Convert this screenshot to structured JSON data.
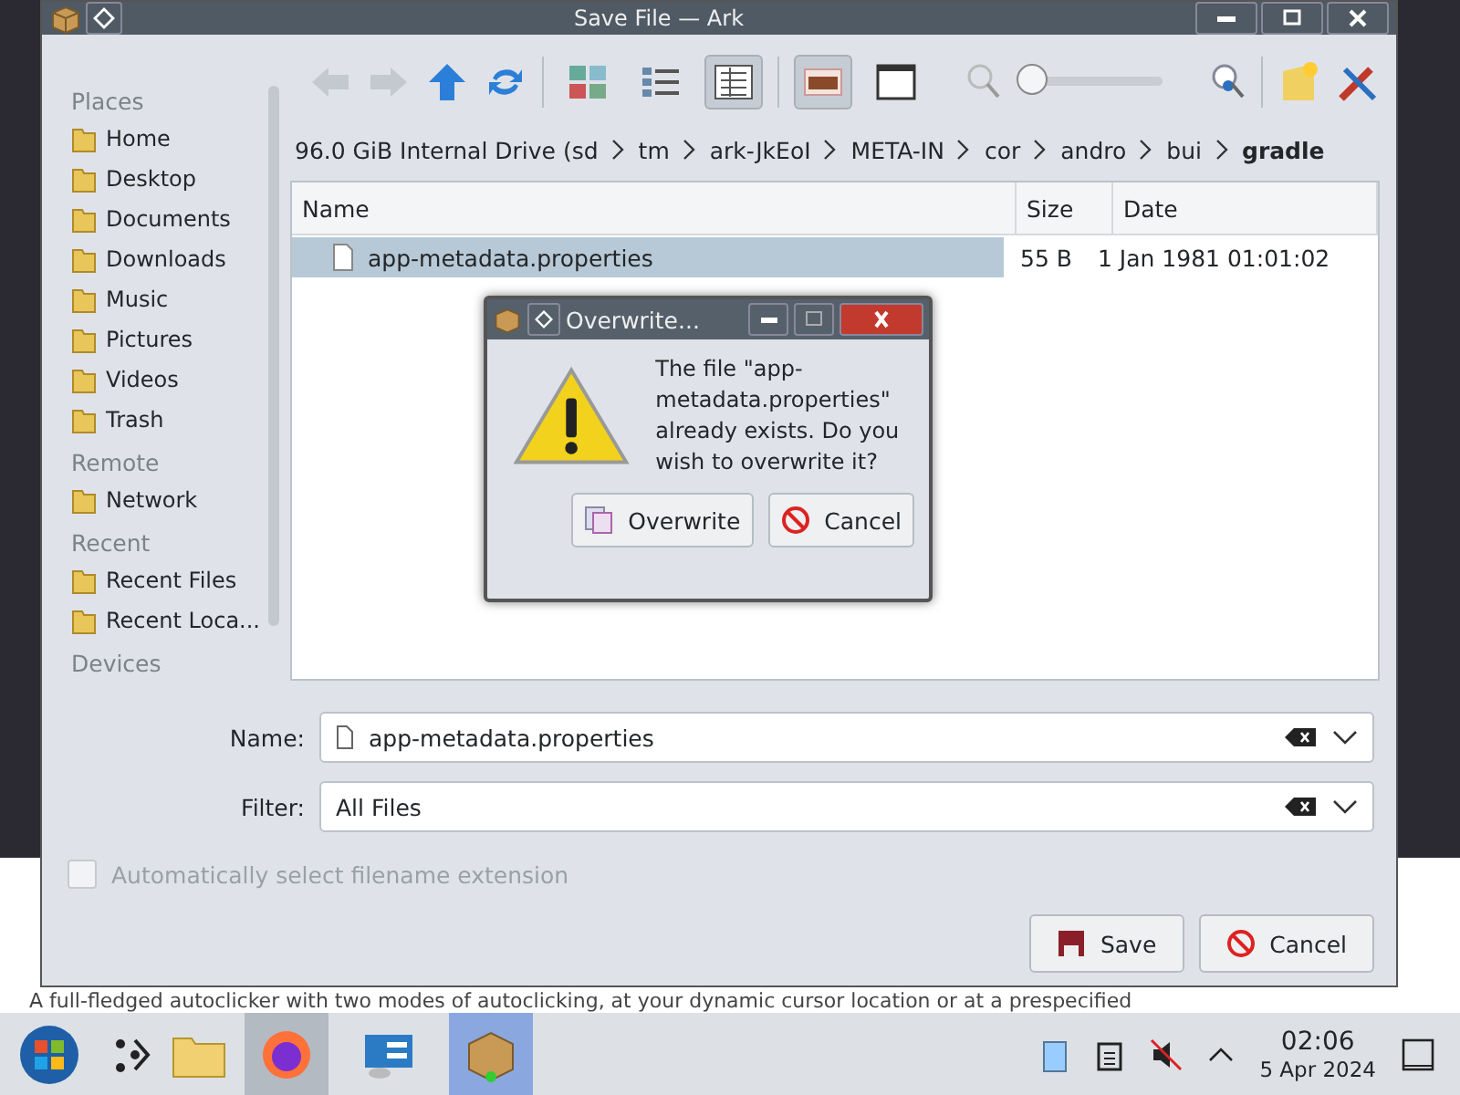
{
  "background_page": {
    "text": "A full-fledged autoclicker with two modes of autoclicking, at your dynamic cursor location or at a prespecified"
  },
  "window": {
    "title": "Save File — Ark"
  },
  "sidebar": {
    "sections": [
      {
        "heading": "Places",
        "items": [
          {
            "label": "Home"
          },
          {
            "label": "Desktop"
          },
          {
            "label": "Documents"
          },
          {
            "label": "Downloads"
          },
          {
            "label": "Music"
          },
          {
            "label": "Pictures"
          },
          {
            "label": "Videos"
          },
          {
            "label": "Trash"
          }
        ]
      },
      {
        "heading": "Remote",
        "items": [
          {
            "label": "Network"
          }
        ]
      },
      {
        "heading": "Recent",
        "items": [
          {
            "label": "Recent Files"
          },
          {
            "label": "Recent Loca..."
          }
        ]
      },
      {
        "heading": "Devices"
      }
    ]
  },
  "toolbar": {
    "view_modes": [
      {
        "selected": false
      },
      {
        "selected": false
      },
      {
        "selected": true
      }
    ],
    "preview": {
      "on": true
    },
    "panel": {
      "on": false
    },
    "zoom": {
      "level": 0.0
    }
  },
  "breadcrumb": [
    {
      "label": "96.0 GiB Internal Drive (sd",
      "current": false
    },
    {
      "label": "tm",
      "current": false
    },
    {
      "label": "ark-JkEoI",
      "current": false
    },
    {
      "label": "META-IN",
      "current": false
    },
    {
      "label": "cor",
      "current": false
    },
    {
      "label": "andro",
      "current": false
    },
    {
      "label": "bui",
      "current": false
    },
    {
      "label": "gradle",
      "current": true
    }
  ],
  "table": {
    "columns": [
      "Name",
      "Size",
      "Date"
    ],
    "rows": [
      {
        "name": "app-metadata.properties",
        "size": "55 B",
        "date": "1 Jan 1981 01:01:02",
        "selected": true
      }
    ]
  },
  "name_field": {
    "label": "Name:",
    "value": "app-metadata.properties"
  },
  "filter_field": {
    "label": "Filter:",
    "value": "All Files"
  },
  "auto_extension": {
    "label": "Automatically select filename extension",
    "checked": false,
    "disabled": true
  },
  "buttons": [
    "Save",
    "Cancel"
  ],
  "overwrite_dialog": {
    "title": "Overwrite...",
    "message": "The file \"app-metadata.properties\" already exists. Do you wish to overwrite it?",
    "buttons": [
      "Overwrite",
      "Cancel"
    ]
  },
  "taskbar": {
    "items": [
      {
        "selected": false
      },
      {
        "selected": true
      },
      {
        "selected": false
      },
      {
        "selected": true
      }
    ],
    "time": "02:06",
    "date": "5 Apr 2024"
  }
}
